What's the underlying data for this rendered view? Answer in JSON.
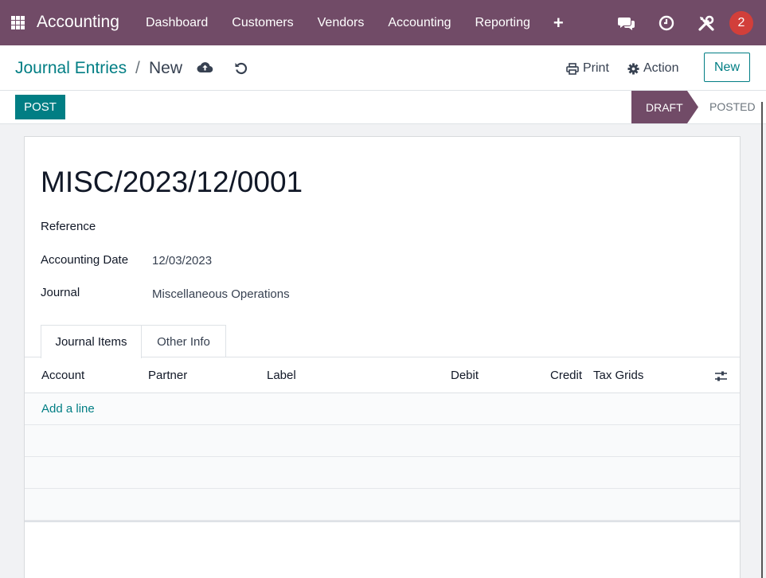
{
  "nav": {
    "app_name": "Accounting",
    "menu": [
      "Dashboard",
      "Customers",
      "Vendors",
      "Accounting",
      "Reporting"
    ],
    "notification_count": "2",
    "colors": {
      "bar": "#714B67",
      "badge": "#d23f3a"
    }
  },
  "breadcrumb": {
    "parent": "Journal Entries",
    "separator": "/",
    "current": "New"
  },
  "toolbar": {
    "print_label": "Print",
    "action_label": "Action",
    "new_label": "New"
  },
  "status": {
    "post_label": "POST",
    "stages": [
      "DRAFT",
      "POSTED"
    ],
    "active_stage": "DRAFT",
    "accent": "#017e84"
  },
  "entry": {
    "name": "MISC/2023/12/0001",
    "fields": [
      {
        "label": "Reference",
        "value": ""
      },
      {
        "label": "Accounting Date",
        "value": "12/03/2023"
      },
      {
        "label": "Journal",
        "value": "Miscellaneous Operations"
      }
    ]
  },
  "tabs": [
    "Journal Items",
    "Other Info"
  ],
  "table": {
    "columns": [
      "Account",
      "Partner",
      "Label",
      "Debit",
      "Credit",
      "Tax Grids"
    ],
    "add_line": "Add a line"
  }
}
